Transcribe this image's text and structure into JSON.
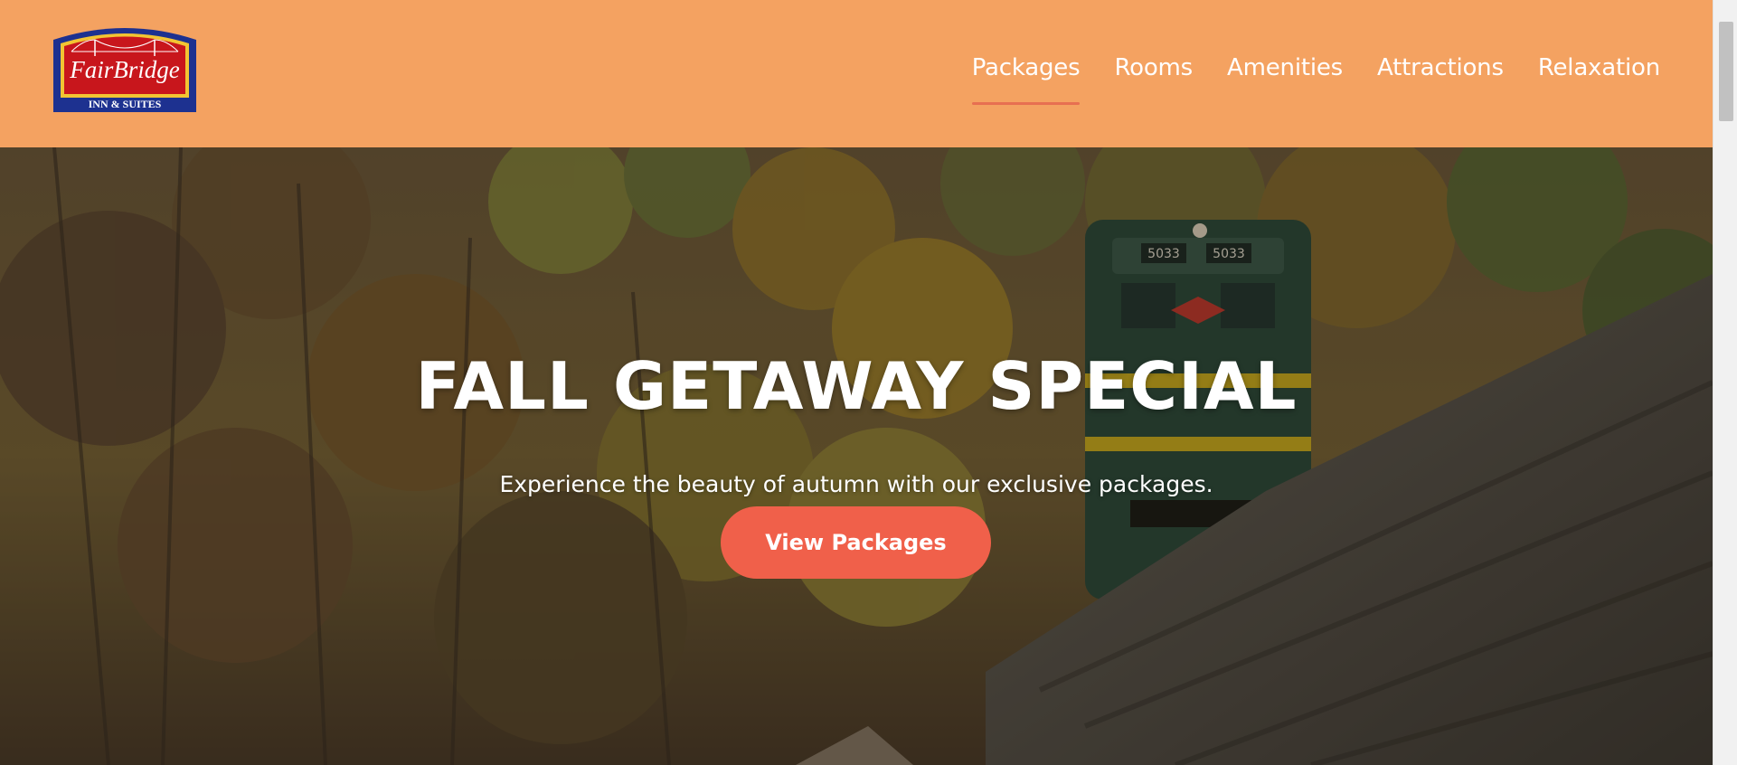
{
  "logo": {
    "brand": "FairBridge",
    "tagline": "INN & SUITES"
  },
  "nav": {
    "items": [
      {
        "label": "Packages",
        "active": true
      },
      {
        "label": "Rooms"
      },
      {
        "label": "Amenities"
      },
      {
        "label": "Attractions"
      },
      {
        "label": "Relaxation"
      }
    ]
  },
  "hero": {
    "title": "FALL GETAWAY SPECIAL",
    "subtitle": "Experience the beauty of autumn with our exclusive packages.",
    "cta_label": "View Packages",
    "train_number": "5033"
  },
  "colors": {
    "header_bg": "#f4a261",
    "accent": "#e76f51",
    "button_bg": "#f0604a"
  }
}
